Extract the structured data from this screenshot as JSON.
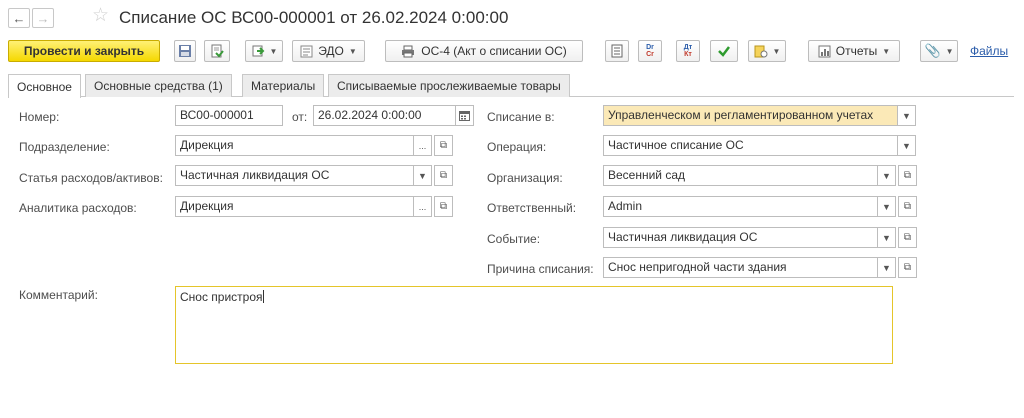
{
  "header": {
    "title": "Списание ОС ВС00-000001 от 26.02.2024 0:00:00"
  },
  "toolbar": {
    "post_close": "Провести и закрыть",
    "edo": "ЭДО",
    "print_os4": "ОС-4 (Акт о списании ОС)",
    "dt_top": "Дт",
    "dt_bottom": "Кт",
    "dr_top": "Dr",
    "dr_bottom": "Cr",
    "reports": "Отчеты",
    "files": "Файлы"
  },
  "tabs": [
    {
      "label": "Основное"
    },
    {
      "label": "Основные средства (1)"
    },
    {
      "label": "Материалы"
    },
    {
      "label": "Списываемые прослеживаемые товары"
    }
  ],
  "form": {
    "number_label": "Номер:",
    "number_value": "ВС00-000001",
    "date_label": "от:",
    "date_value": "26.02.2024  0:00:00",
    "department_label": "Подразделение:",
    "department_value": "Дирекция",
    "expense_item_label": "Статья расходов/активов:",
    "expense_item_value": "Частичная ликвидация ОС",
    "expense_analytics_label": "Аналитика расходов:",
    "expense_analytics_value": "Дирекция",
    "writeoff_in_label": "Списание в:",
    "writeoff_in_value": "Управленческом и регламентированном учетах",
    "operation_label": "Операция:",
    "operation_value": "Частичное списание ОС",
    "organization_label": "Организация:",
    "organization_value": "Весенний сад",
    "responsible_label": "Ответственный:",
    "responsible_value": "Admin",
    "event_label": "Событие:",
    "event_value": "Частичная ликвидация ОС",
    "reason_label": "Причина списания:",
    "reason_value": "Снос непригодной части здания",
    "comment_label": "Комментарий:",
    "comment_value": "Снос пристроя"
  },
  "colors": {
    "primary_button": "#f5d800",
    "highlight_field": "#fbe9b7",
    "link": "#2a5caa",
    "comment_border": "#e5c52a"
  }
}
